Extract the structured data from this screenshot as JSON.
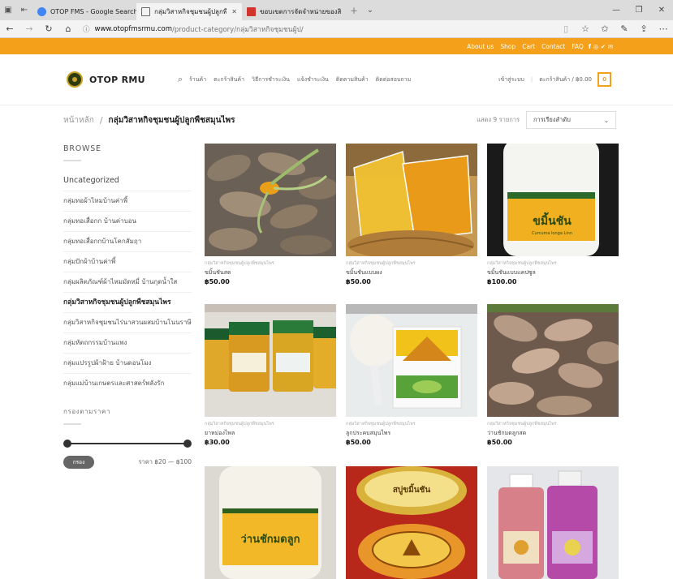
{
  "browser": {
    "tabs": [
      {
        "title": "OTOP FMS - Google Search",
        "active": false
      },
      {
        "title": "กลุ่มวิสาหกิจชุมชนผู้ปลูกพื",
        "active": true
      },
      {
        "title": "ขอบเขตการจัดจำหน่ายของสินค้ำ",
        "active": false
      }
    ],
    "url_host": "www.otopfmsrmu.com",
    "url_path": "/product-category/กลุ่มวิสาหกิจชุมชนผู้ป/"
  },
  "topbar": {
    "links": [
      "About us",
      "Shop",
      "Cart",
      "Contact",
      "FAQ"
    ],
    "social": "f ◎ ✔ ✉"
  },
  "header": {
    "logo": "OTOP RMU",
    "menu": [
      "ร้านค้า",
      "ตะกร้าสินค้า",
      "วิธีการชำระเงิน",
      "แจ้งชำระเงิน",
      "ติดตามสินค้า",
      "ติดต่อสอบถาม"
    ],
    "login": "เข้าสู่ระบบ",
    "cart_label": "ตะกร้าสินค้า / ฿0.00",
    "cart_count": "0"
  },
  "breadcrumb": {
    "home": "หน้าหลัก",
    "separator": "/",
    "current": "กลุ่มวิสาหกิจชุมชนผู้ปลูกพืชสมุนไพร"
  },
  "result_count": "แสดง 9 รายการ",
  "sort": {
    "selected": "การเรียงลำดับ"
  },
  "sidebar": {
    "browse_title": "BROWSE",
    "categories": [
      "Uncategorized",
      "กลุ่มทอผ้าไหมบ้านค่าพี้",
      "กลุ่มทอเสื่อกก บ้านค่าบอน",
      "กลุ่มทอเสื่อกกบ้านโคกสัมฤา",
      "กลุ่มปักผ้าบ้านค่าพี้",
      "กลุ่มผลิตภัณฑ์ผ้าไหมมัดหมี่ บ้านกุดน้ำใส",
      "กลุ่มวิสาหกิจชุมชนผู้ปลูกพืชสมุนไพร",
      "กลุ่มวิสาหกิจชุมชนไร่นาสวนผสมบ้านโนนราษี",
      "กลุ่มหัตถกรรมบ้านแพง",
      "กลุ่มแปรรูปผ้าฝ้าย บ้านดอนโมง",
      "กลุ่มแม่บ้านเกษตรและศาสตร์พลังรัก"
    ],
    "active_index": 6,
    "filter_title": "กรองตามราคา",
    "filter_button": "กรอง",
    "price_range": "ราคา ฿20 — ฿100"
  },
  "products": [
    {
      "category": "กลุ่มวิสาหกิจชุมชนผู้ปลูกพืชสมุนไพร",
      "name": "ขมิ้นชันสด",
      "price": "฿50.00",
      "image": "turmeric-root"
    },
    {
      "category": "กลุ่มวิสาหกิจชุมชนผู้ปลูกพืชสมุนไพร",
      "name": "ขมิ้นชันแบบผง",
      "price": "฿50.00",
      "image": "turmeric-powder"
    },
    {
      "category": "กลุ่มวิสาหกิจชุมชนผู้ปลูกพืชสมุนไพร",
      "name": "ขมิ้นชันแบบแคปซูล",
      "price": "฿100.00",
      "image": "capsule-jar"
    },
    {
      "category": "กลุ่มวิสาหกิจชุมชนผู้ปลูกพืชสมุนไพร",
      "name": "ยาหม่องไพล",
      "price": "฿30.00",
      "image": "balm-jars"
    },
    {
      "category": "กลุ่มวิสาหกิจชุมชนผู้ปลูกพืชสมุนไพร",
      "name": "ลูกประคบสมุนไพร",
      "price": "฿50.00",
      "image": "herbal-compress"
    },
    {
      "category": "กลุ่มวิสาหกิจชุมชนผู้ปลูกพืชสมุนไพร",
      "name": "ว่านชักมดลูกสด",
      "price": "฿50.00",
      "image": "root-pile"
    },
    {
      "category": "",
      "name": "",
      "price": "",
      "image": "herb-jar",
      "jar_label": "ว่านชักมดลูก"
    },
    {
      "category": "",
      "name": "",
      "price": "",
      "image": "soap-jar",
      "jar_label": "สบู่ขมิ้นชัน"
    },
    {
      "category": "",
      "name": "",
      "price": "",
      "image": "shampoo-bottles"
    }
  ],
  "colors": {
    "accent": "#f5a01a",
    "tabbar": "#dcdcdc"
  }
}
